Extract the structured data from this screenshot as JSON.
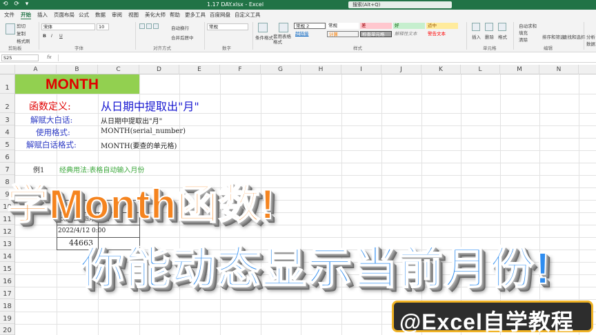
{
  "titlebar": {
    "quick_access": "⟲ ⟳ ▾",
    "title": "1.17 DAY.xlsx - Excel",
    "search": "搜索(Alt+Q)"
  },
  "menu": {
    "tabs": [
      "文件",
      "开始",
      "插入",
      "页面布局",
      "公式",
      "数据",
      "审阅",
      "视图",
      "美化大师",
      "帮助",
      "更多工具",
      "百度网盘",
      "自定义工具"
    ]
  },
  "ribbon": {
    "clipboard": {
      "cut": "剪切",
      "copy": "复制",
      "format_painter": "格式刷",
      "label": "剪贴板"
    },
    "font": {
      "name": "宋体",
      "size": "10",
      "bold": "B",
      "italic": "I",
      "underline": "U",
      "label": "字体"
    },
    "alignment": {
      "wrap": "自动换行",
      "merge": "合并后居中",
      "label": "对齐方式"
    },
    "number": {
      "format": "常规",
      "label": "数字"
    },
    "styles": {
      "conditional": "条件格式",
      "table_format": "套用表格格式",
      "cells": [
        "常规 2",
        "常规",
        "差",
        "好",
        "适中",
        "超链接",
        "计算",
        "检查单元格",
        "解释性文本",
        "警告文本"
      ],
      "label": "样式"
    },
    "cells": {
      "insert": "插入",
      "delete": "删除",
      "format": "格式",
      "label": "单元格"
    },
    "editing": {
      "autosum": "自动求和",
      "fill": "填充",
      "clear": "清除",
      "sort": "排序和筛选",
      "find": "查找和选择",
      "label": "编辑"
    },
    "extra": {
      "label": "分析数据"
    }
  },
  "formula_bar": {
    "name_box": "S25",
    "fx": "fx",
    "content": ""
  },
  "grid": {
    "columns": [
      "A",
      "B",
      "C",
      "D",
      "E",
      "F",
      "G",
      "H",
      "I",
      "J",
      "K",
      "L",
      "M",
      "N"
    ],
    "rows": [
      "1",
      "2",
      "3",
      "4",
      "5",
      "6",
      "7",
      "8",
      "9",
      "10",
      "11",
      "12",
      "13",
      "14",
      "15",
      "16",
      "17",
      "18",
      "19",
      "20"
    ]
  },
  "sheet": {
    "month_title": "MONTH",
    "def_label": "函数定义:",
    "def_value": "从日期中提取出\"月\"",
    "plain_label": "解赋大白话:",
    "plain_value": "从日期中提取出\"月\"",
    "usage_label": "使用格式:",
    "usage_value": "MONTH(serial_number)",
    "plain_usage_label": "解赋白话格式:",
    "plain_usage_value": "MONTH(要查的单元格)",
    "example_label": "例1",
    "example_desc": "经典用法:表格自动输入月份",
    "cell_b11": "二〇二二年四月十二日",
    "cell_b12": "2022/4/12 0:00",
    "cell_b13": "44663"
  },
  "overlays": {
    "headline": "学Month函数!",
    "subline": "你能动态显示当前月份!",
    "brand": "@Excel自学教程"
  }
}
